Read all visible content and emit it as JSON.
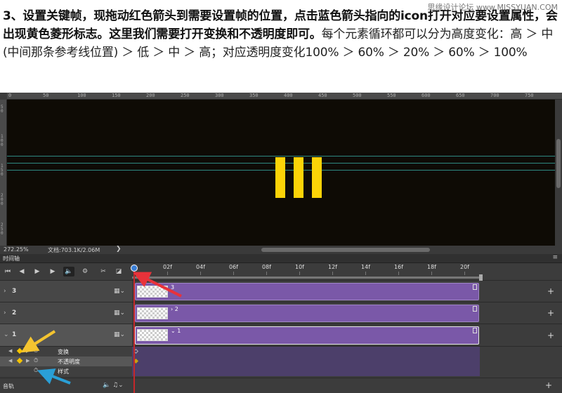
{
  "article": {
    "bold_text": "3、设置关键帧，现拖动红色箭头到需要设置帧的位置，点击蓝色箭头指向的icon打开对应要设置属性，会出现黄色菱形标志。这里我们需要打开变换和不透明度即可。",
    "normal_text": "每个元素循环都可以分为高度变化：高 ＞ 中(中间那条参考线位置) ＞ 低 ＞ 中 ＞ 高；对应透明度变化100% ＞ 60% ＞ 20% ＞ 60% ＞ 100%",
    "watermark": "思缘设计论坛 www.MISSYUAN.COM"
  },
  "ruler_top": [
    "0",
    "50",
    "100",
    "150",
    "200",
    "250",
    "300",
    "350",
    "400",
    "450",
    "500",
    "550",
    "600",
    "650",
    "700",
    "750"
  ],
  "ruler_left": [
    "5 0",
    "1 0 0",
    "1 5 0",
    "2 0 0",
    "2 5 0"
  ],
  "status": {
    "zoom": "272.25%",
    "doc": "文档:703.1K/2.06M",
    "arrow": "❯"
  },
  "colors": {
    "bar": "#fcd307",
    "canvas": "#0e0b05",
    "guide": "#2f8a82",
    "clip": "#7a58a8",
    "playhead": "#c5272a",
    "keyframe": "#f5c400"
  },
  "timeline": {
    "title": "时间轴",
    "menu": "≡",
    "controls": {
      "first_frame": "⏮",
      "prev_frame": "◀",
      "play": "▶",
      "next_frame": "▶",
      "audio": "🔈",
      "settings": "⚙",
      "split": "✂",
      "transition": "◪"
    },
    "frame_labels": [
      "02f",
      "04f",
      "06f",
      "08f",
      "10f",
      "12f",
      "14f",
      "16f",
      "18f",
      "20f"
    ],
    "layers": [
      {
        "name": "3",
        "clip_label": "3",
        "chevron": "›"
      },
      {
        "name": "2",
        "clip_label": "› 2",
        "chevron": "›"
      },
      {
        "name": "1",
        "clip_label": "⌄ 1",
        "chevron": "⌄"
      }
    ],
    "properties": [
      {
        "name": "变换",
        "stopwatch": "⏱"
      },
      {
        "name": "不透明度",
        "stopwatch": "⏱"
      },
      {
        "name": "样式",
        "stopwatch": "⏱"
      }
    ],
    "film_icon": "▦⌄",
    "plus": "+",
    "audio_track": {
      "name": "音轨",
      "icons": "🔈 ♫⌄",
      "plus": "+"
    }
  }
}
